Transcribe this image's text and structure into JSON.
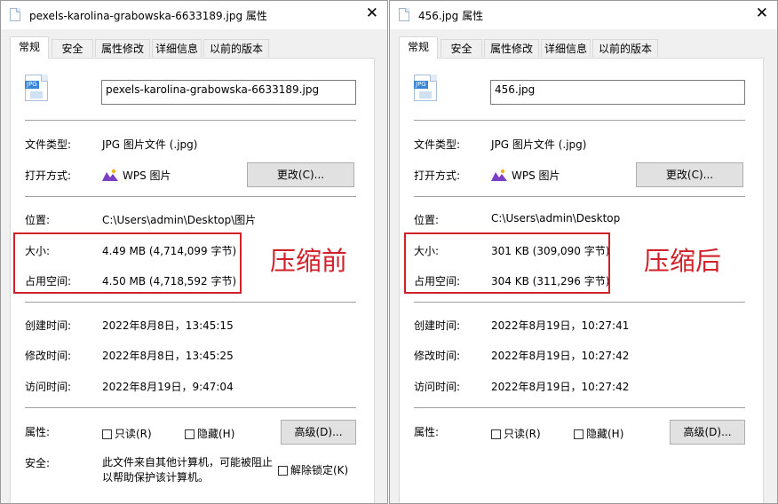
{
  "dialogs": [
    {
      "title": "pexels-karolina-grabowska-6633189.jpg 属性",
      "close_glyph": "✕",
      "tabs": [
        "常规",
        "安全",
        "属性修改",
        "详细信息",
        "以前的版本"
      ],
      "file_icon_label": "JPG",
      "filename": "pexels-karolina-grabowska-6633189.jpg",
      "file_type_label": "文件类型:",
      "file_type": "JPG 图片文件 (.jpg)",
      "open_with_label": "打开方式:",
      "open_with": "WPS 图片",
      "change_button": "更改(C)...",
      "location_label": "位置:",
      "location": "C:\\Users\\admin\\Desktop\\图片",
      "size_label": "大小:",
      "size": "4.49 MB (4,714,099 字节)",
      "disk_label": "占用空间:",
      "disk": "4.50 MB (4,718,592 字节)",
      "created_label": "创建时间:",
      "created": "2022年8月8日，13:45:15",
      "modified_label": "修改时间:",
      "modified": "2022年8月8日，13:45:25",
      "accessed_label": "访问时间:",
      "accessed": "2022年8月19日，9:47:04",
      "attributes_label": "属性:",
      "readonly_label": "只读(R)",
      "hidden_label": "隐藏(H)",
      "advanced_button": "高级(D)...",
      "security_label": "安全:",
      "security_line1": "此文件来自其他计算机，可能被阻止",
      "security_line2": "以帮助保护该计算机。",
      "unblock_label": "解除锁定(K)",
      "annotation": "压缩前"
    },
    {
      "title": "456.jpg 属性",
      "close_glyph": "✕",
      "tabs": [
        "常规",
        "安全",
        "属性修改",
        "详细信息",
        "以前的版本"
      ],
      "file_icon_label": "JPG",
      "filename": "456.jpg",
      "file_type_label": "文件类型:",
      "file_type": "JPG 图片文件 (.jpg)",
      "open_with_label": "打开方式:",
      "open_with": "WPS 图片",
      "change_button": "更改(C)...",
      "location_label": "位置:",
      "location": "C:\\Users\\admin\\Desktop",
      "size_label": "大小:",
      "size": "301 KB (309,090 字节)",
      "disk_label": "占用空间:",
      "disk": "304 KB (311,296 字节)",
      "created_label": "创建时间:",
      "created": "2022年8月19日，10:27:41",
      "modified_label": "修改时间:",
      "modified": "2022年8月19日，10:27:42",
      "accessed_label": "访问时间:",
      "accessed": "2022年8月19日，10:27:42",
      "attributes_label": "属性:",
      "readonly_label": "只读(R)",
      "hidden_label": "隐藏(H)",
      "advanced_button": "高级(D)...",
      "annotation": "压缩后"
    }
  ],
  "colors": {
    "annotation_red": "#d0212a",
    "dialog_bg": "#f0f0f0",
    "panel_bg": "#ffffff",
    "button_bg": "#e1e1e1"
  },
  "icons": {
    "file": "jpg-file-icon",
    "title": "jpg-file-icon",
    "app": "wps-photo-icon",
    "close": "close-icon"
  }
}
